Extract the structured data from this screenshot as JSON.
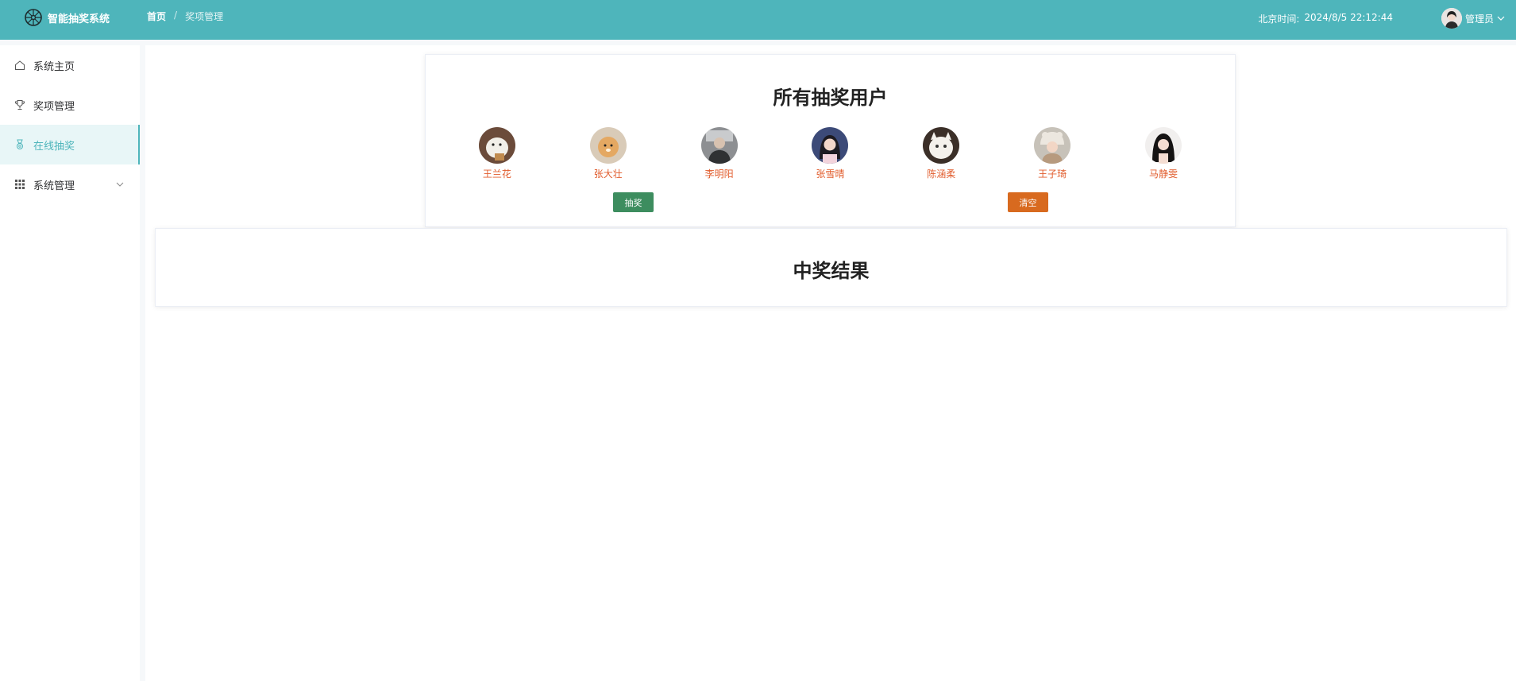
{
  "header": {
    "app_title": "智能抽奖系统",
    "breadcrumb": {
      "home": "首页",
      "separator": "/",
      "current": "奖项管理"
    },
    "clock_label": "北京时间:",
    "clock_value": "2024/8/5 22:12:44",
    "user_name": "管理员"
  },
  "sidebar": {
    "items": [
      {
        "label": "系统主页",
        "icon": "home-icon"
      },
      {
        "label": "奖项管理",
        "icon": "trophy-icon"
      },
      {
        "label": "在线抽奖",
        "icon": "medal-icon",
        "active": true
      },
      {
        "label": "系统管理",
        "icon": "grid-icon",
        "has_submenu": true
      }
    ]
  },
  "lottery": {
    "title": "所有抽奖用户",
    "users": [
      {
        "name": "王兰花"
      },
      {
        "name": "张大壮"
      },
      {
        "name": "李明阳"
      },
      {
        "name": "张雪晴"
      },
      {
        "name": "陈涵柔"
      },
      {
        "name": "王子琦"
      },
      {
        "name": "马静雯"
      }
    ],
    "draw_label": "抽奖",
    "clear_label": "清空"
  },
  "result": {
    "title": "中奖结果"
  },
  "colors": {
    "accent": "#4eb5bb",
    "draw_button": "#3d8d5f",
    "clear_button": "#d86a1f",
    "user_name": "#e15c2c"
  }
}
